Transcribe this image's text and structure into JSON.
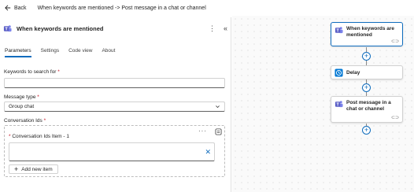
{
  "header": {
    "back_label": "Back",
    "flow_title": "When keywords are mentioned -> Post message in a chat or channel"
  },
  "panel": {
    "title": "When keywords are mentioned",
    "tabs": [
      {
        "label": "Parameters",
        "active": true
      },
      {
        "label": "Settings",
        "active": false
      },
      {
        "label": "Code view",
        "active": false
      },
      {
        "label": "About",
        "active": false
      }
    ],
    "keywords": {
      "label": "Keywords to search for",
      "required_mark": "*",
      "value": ""
    },
    "message_type": {
      "label": "Message type",
      "required_mark": "*",
      "value": "Group chat"
    },
    "conversation_ids": {
      "label": "Conversation Ids",
      "required_mark": "*",
      "item_label": "Conversation Ids Item - 1",
      "item_required_mark": "*",
      "item_value": "",
      "add_label": "Add new item"
    }
  },
  "canvas": {
    "nodes": [
      {
        "label": "When keywords are mentioned",
        "icon": "teams-icon",
        "selected": true
      },
      {
        "label": "Delay",
        "icon": "delay-icon",
        "selected": false
      },
      {
        "label": "Post message in a chat or channel",
        "icon": "teams-icon",
        "selected": false
      }
    ]
  },
  "colors": {
    "accent": "#0f6cbd",
    "required": "#c50f1f",
    "teams": "#5b5fc7",
    "delay": "#0078d4"
  }
}
